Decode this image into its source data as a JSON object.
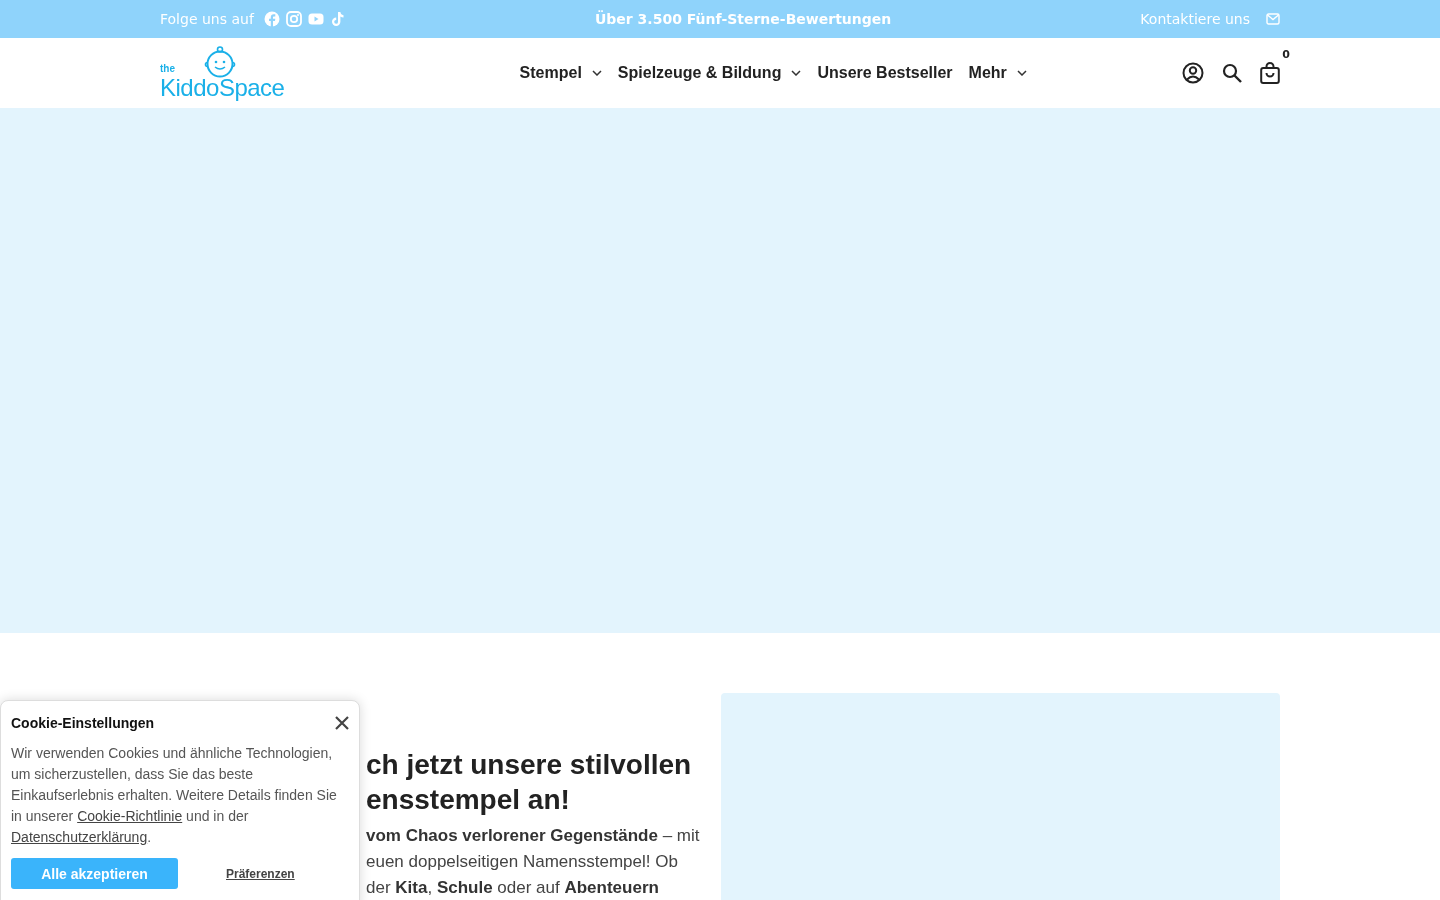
{
  "announcement_bar": {
    "follow_label": "Folge uns auf",
    "social_links": [
      {
        "kind": "facebook"
      },
      {
        "kind": "instagram"
      },
      {
        "kind": "youtube"
      },
      {
        "kind": "tiktok"
      }
    ],
    "message": "Über 3.500 Fünf-Sterne-Bewertungen",
    "contact_label": "Kontaktiere uns"
  },
  "header": {
    "logo": {
      "small": "the",
      "name": "KiddoSpace"
    },
    "nav": [
      {
        "label": "Stempel",
        "has_dropdown": true
      },
      {
        "label": "Spielzeuge & Bildung",
        "has_dropdown": true
      },
      {
        "label": "Unsere Bestseller",
        "has_dropdown": false
      },
      {
        "label": "Mehr",
        "has_dropdown": true
      }
    ],
    "cart_count": "0"
  },
  "section": {
    "heading_lines": [
      "ch jetzt unsere stilvollen",
      "ensstempel an!"
    ],
    "paragraph_lines": [
      "**vom Chaos verlorener Gegenstände** – mit",
      "euen doppelseitigen Namensstempel! Ob",
      "der **Kita**, **Schule** oder auf **Abenteuern**"
    ]
  },
  "cookie_banner": {
    "title": "Cookie-Einstellungen",
    "text_before": "Wir verwenden Cookies und ähnliche Technologien, um sicherzustellen, dass Sie das beste Einkaufserlebnis erhalten. Weitere Details finden Sie in unserer ",
    "policy_link": "Cookie-Richtlinie",
    "text_middle": " und in der ",
    "privacy_link": "Datenschutzerklärung",
    "text_after": ".",
    "accept_button": "Alle akzeptieren",
    "preferences_button": "Präferenzen"
  }
}
